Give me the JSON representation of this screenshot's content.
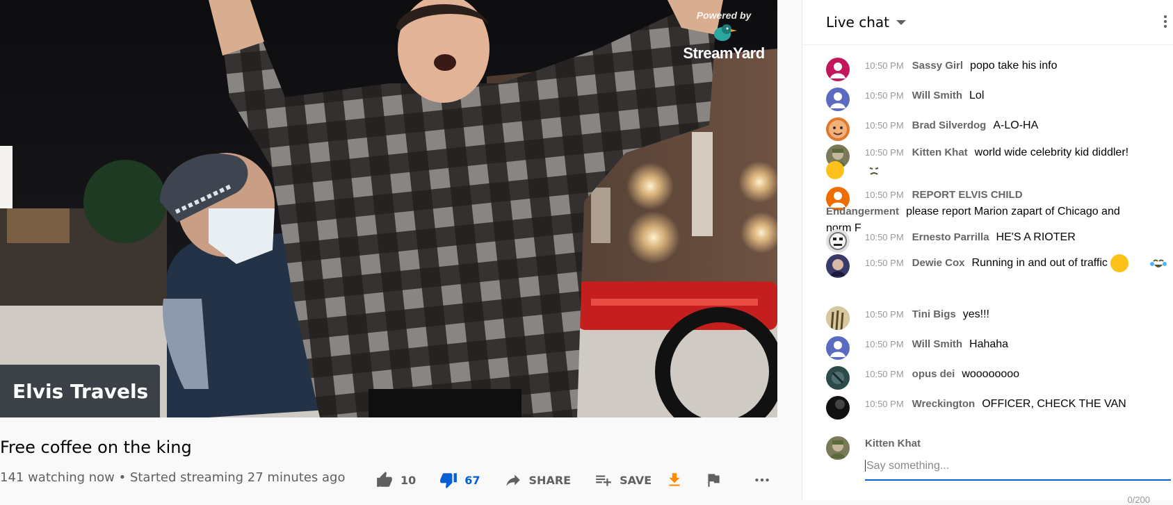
{
  "video": {
    "watermark_powered": "Powered by",
    "watermark_brand": "StreamYard",
    "channel_overlay": "Elvis Travels"
  },
  "info": {
    "title": "Free coffee on the king",
    "meta": "141 watching now • Started streaming 27 minutes ago"
  },
  "actions": {
    "like_count": "10",
    "dislike_count": "67",
    "share_label": "SHARE",
    "save_label": "SAVE"
  },
  "chat": {
    "header": "Live chat",
    "messages": [
      {
        "time": "10:50 PM",
        "author": "Sassy Girl",
        "text": "popo take his info",
        "avatar_color": "#c2185b"
      },
      {
        "time": "10:50 PM",
        "author": "Will Smith",
        "text": "Lol",
        "avatar_color": "#5c6bc0"
      },
      {
        "time": "10:50 PM",
        "author": "Brad Silverdog",
        "text": "A-LO-HA",
        "avatar_color": "#e0792c"
      },
      {
        "time": "10:50 PM",
        "author": "Kitten Khat",
        "text": "world wide celebrity kid diddler!",
        "avatar_color": "#7a7a5a"
      },
      {
        "time": "10:50 PM",
        "author": "REPORT ELVIS CHILD Endangerment",
        "text": "please report Marion zapart of Chicago and norm F",
        "avatar_color": "#ef6c00"
      },
      {
        "time": "10:50 PM",
        "author": "Ernesto Parrilla",
        "text": "HE'S A RIOTER",
        "avatar_color": "#9e9e9e"
      },
      {
        "time": "10:50 PM",
        "author": "Dewie Cox",
        "text": "Running in and out of traffic",
        "avatar_color": "#3a3a6a"
      },
      {
        "time": "10:50 PM",
        "author": "Tini Bigs",
        "text": "yes!!!",
        "avatar_color": "#a08a50"
      },
      {
        "time": "10:50 PM",
        "author": "Will Smith",
        "text": "Hahaha",
        "avatar_color": "#5c6bc0"
      },
      {
        "time": "10:50 PM",
        "author": "opus dei",
        "text": "woooooooo",
        "avatar_color": "#2e4a4a"
      },
      {
        "time": "10:50 PM",
        "author": "Wreckington",
        "text": "OFFICER, CHECK THE VAN",
        "avatar_color": "#111111"
      }
    ],
    "input_user": "Kitten Khat",
    "input_placeholder": "Say something...",
    "counter": "0/200"
  },
  "icons": {
    "like": "thumbs-up-icon",
    "dislike": "thumbs-down-icon",
    "share": "share-arrow-icon",
    "save": "playlist-add-icon",
    "download": "download-icon",
    "report": "flag-icon",
    "more": "more-horizontal-icon",
    "chat_menu": "more-vertical-icon"
  }
}
